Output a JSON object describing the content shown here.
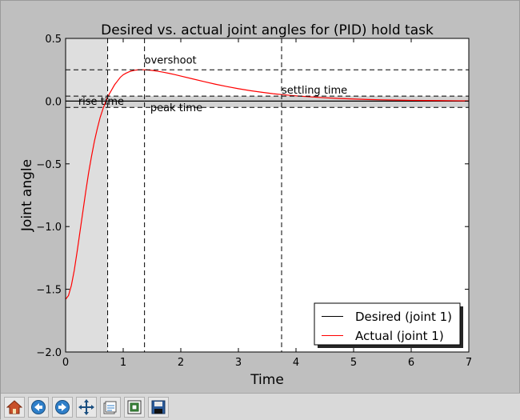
{
  "chart_data": {
    "type": "line",
    "title": "Desired vs. actual joint angles for (PID) hold task",
    "xlabel": "Time",
    "ylabel": "Joint angle",
    "xlim": [
      0,
      7
    ],
    "ylim": [
      -2.0,
      0.5
    ],
    "xticks": [
      0,
      1,
      2,
      3,
      4,
      5,
      6,
      7
    ],
    "xtick_labels": [
      "0",
      "1",
      "2",
      "3",
      "4",
      "5",
      "6",
      "7"
    ],
    "yticks": [
      -2.0,
      -1.5,
      -1.0,
      -0.5,
      0.0,
      0.5
    ],
    "ytick_labels": [
      "−2.0",
      "−1.5",
      "−1.0",
      "−0.5",
      "0.0",
      "0.5"
    ],
    "grid": false,
    "legend_position": "lower-right",
    "series": [
      {
        "name": "Desired (joint 1)",
        "color": "#000000",
        "x": [
          0,
          7
        ],
        "y": [
          0,
          0
        ]
      },
      {
        "name": "Actual (joint 1)",
        "color": "#ff0000",
        "x": [
          0,
          0.05,
          0.1,
          0.15,
          0.2,
          0.25,
          0.3,
          0.35,
          0.4,
          0.45,
          0.5,
          0.55,
          0.6,
          0.65,
          0.7,
          0.75,
          0.8,
          0.85,
          0.9,
          0.95,
          1.0,
          1.05,
          1.1,
          1.15,
          1.2,
          1.25,
          1.3,
          1.35,
          1.4,
          1.45,
          1.5,
          1.6,
          1.7,
          1.8,
          1.9,
          2.0,
          2.2,
          2.4,
          2.6,
          2.8,
          3.0,
          3.2,
          3.4,
          3.6,
          3.8,
          4.0,
          4.25,
          4.5,
          4.75,
          5.0,
          5.25,
          5.5,
          5.75,
          6.0,
          6.25,
          6.5,
          6.75,
          7.0
        ],
        "y": [
          -1.58,
          -1.55,
          -1.47,
          -1.35,
          -1.2,
          -1.04,
          -0.88,
          -0.72,
          -0.57,
          -0.44,
          -0.32,
          -0.22,
          -0.13,
          -0.06,
          0.0,
          0.05,
          0.09,
          0.13,
          0.16,
          0.19,
          0.21,
          0.223,
          0.233,
          0.241,
          0.246,
          0.249,
          0.25,
          0.25,
          0.249,
          0.247,
          0.245,
          0.238,
          0.23,
          0.221,
          0.211,
          0.2,
          0.178,
          0.156,
          0.135,
          0.116,
          0.099,
          0.084,
          0.071,
          0.059,
          0.05,
          0.042,
          0.034,
          0.027,
          0.021,
          0.017,
          0.013,
          0.01,
          0.008,
          0.006,
          0.005,
          0.004,
          0.003,
          0.002
        ]
      }
    ],
    "settling_band": [
      -0.05,
      0.04
    ],
    "rise_time_shade_until": 0.73,
    "markers": [
      {
        "label": "rise time",
        "axis": "x",
        "value": 0.73,
        "text_x": 0.22,
        "text_y": -0.03
      },
      {
        "label": "peak time",
        "axis": "x",
        "value": 1.37,
        "text_x": 1.47,
        "text_y": -0.08
      },
      {
        "label": "settling time",
        "axis": "x",
        "value": 3.75,
        "text_x": 3.75,
        "text_y": 0.06
      },
      {
        "label": "overshoot",
        "axis": "y",
        "value": 0.25,
        "text_x": 1.37,
        "text_y": 0.3
      }
    ]
  },
  "toolbar": {
    "buttons": [
      {
        "name": "home-button",
        "icon": "home-icon"
      },
      {
        "name": "back-button",
        "icon": "arrow-left-icon"
      },
      {
        "name": "forward-button",
        "icon": "arrow-right-icon"
      },
      {
        "name": "pan-button",
        "icon": "move-icon"
      },
      {
        "name": "configure-subplots-button",
        "icon": "subplots-icon"
      },
      {
        "name": "zoom-rect-button",
        "icon": "zoom-rect-icon"
      },
      {
        "name": "save-button",
        "icon": "floppy-disk-icon"
      }
    ]
  }
}
